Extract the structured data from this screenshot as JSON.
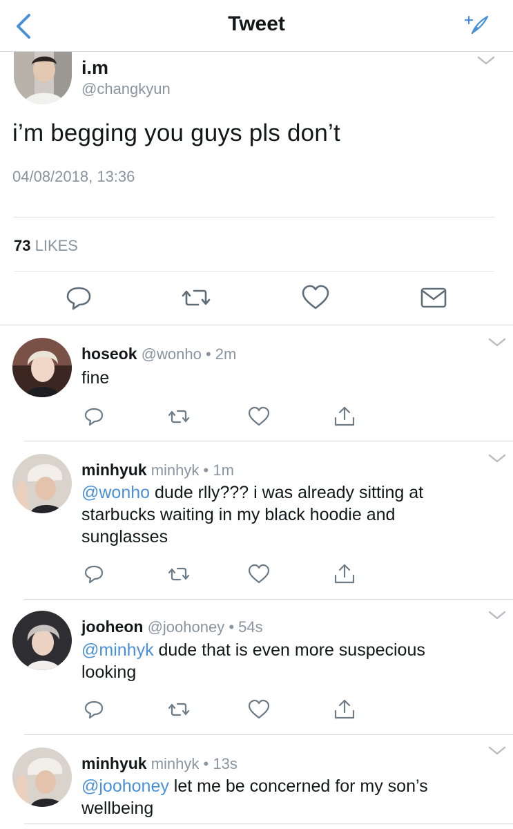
{
  "nav": {
    "title": "Tweet"
  },
  "main_tweet": {
    "name": "i.m",
    "handle": "@changkyun",
    "text": "i’m begging you guys pls don’t",
    "timestamp": "04/08/2018, 13:36",
    "likes_count": "73",
    "likes_label": "LIKES"
  },
  "replies": [
    {
      "name": "hoseok",
      "handle": "@wonho",
      "dot": "•",
      "time": "2m",
      "mention": "",
      "text": "fine"
    },
    {
      "name": "minhyuk",
      "handle": "minhyk",
      "dot": "•",
      "time": "1m",
      "mention": "@wonho",
      "text": " dude rlly??? i was already sitting at starbucks waiting in my black hoodie and sunglasses"
    },
    {
      "name": "jooheon",
      "handle": "@joohoney",
      "dot": "•",
      "time": "54s",
      "mention": "@minhyk",
      "text": " dude that is even more suspecious looking"
    },
    {
      "name": "minhyuk",
      "handle": "minhyk",
      "dot": "•",
      "time": "13s",
      "mention": "@joohoney",
      "text": " let me be concerned for my son’s wellbeing"
    }
  ],
  "colors": {
    "accent": "#4a90d9",
    "muted": "#8a949e",
    "text": "#14171a",
    "icon": "#6c7a86"
  }
}
